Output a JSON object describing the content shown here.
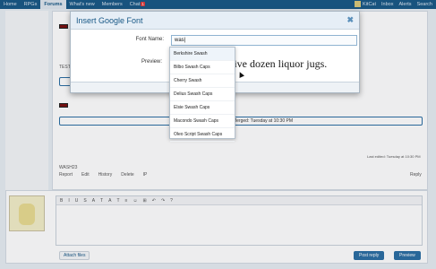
{
  "topnav": {
    "items": [
      {
        "label": "Home"
      },
      {
        "label": "RPGs"
      },
      {
        "label": "Forums"
      },
      {
        "label": "What's new"
      },
      {
        "label": "Members"
      },
      {
        "label": "Chat"
      }
    ],
    "chat_badge": "1",
    "user": "KitCat",
    "inbox": "Inbox",
    "alerts": "Alerts",
    "search": "Search"
  },
  "background": {
    "test_label": "TEST",
    "merged_text": "Merged: Tuesday at 10:30 PM",
    "last_edited": "Last edited: Tuesday at 10:30 PM",
    "username": "WASH23",
    "actions": [
      "Report",
      "Edit",
      "History",
      "Delete",
      "IP"
    ],
    "reply_link": "Reply"
  },
  "editor": {
    "toolbar": [
      "B",
      "I",
      "U",
      "S",
      "A",
      "T",
      "A",
      "T",
      "≡",
      "☺",
      "⊞",
      "↶",
      "↷",
      "?"
    ],
    "attach_label": "Attach files",
    "post_reply_label": "Post reply",
    "preview_label": "Preview"
  },
  "dialog": {
    "title": "Insert Google Font",
    "font_name_label": "Font Name:",
    "font_name_value": "was|",
    "preview_label": "Preview:",
    "preview_text": "with five dozen liquor jugs."
  },
  "dropdown": {
    "options": [
      "Berkshire Swash",
      "Bilbo Swash Caps",
      "Cherry Swash",
      "Delius Swash Caps",
      "Elsie Swash Caps",
      "Macondo Swash Caps",
      "Oleo Script Swash Caps"
    ]
  }
}
